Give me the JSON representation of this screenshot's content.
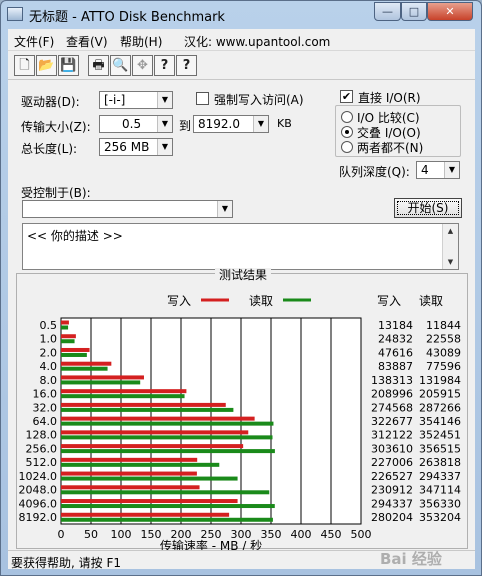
{
  "window": {
    "title": "无标题 - ATTO Disk Benchmark",
    "minimize": "—",
    "maximize": "□",
    "close": "✕"
  },
  "menu": [
    {
      "label": "文件(F)"
    },
    {
      "label": "查看(V)"
    },
    {
      "label": "帮助(H)"
    },
    {
      "label": "汉化: www.upantool.com"
    }
  ],
  "toolbar": [
    {
      "icon": "new-document-icon",
      "glyph": "🗋"
    },
    {
      "icon": "open-folder-icon",
      "glyph": "📂"
    },
    {
      "icon": "save-icon",
      "glyph": "💾"
    },
    {
      "icon": "print-icon",
      "glyph": "🖶"
    },
    {
      "icon": "print-preview-icon",
      "glyph": "🔍"
    },
    {
      "icon": "move-icon",
      "glyph": "✥"
    },
    {
      "icon": "help-icon",
      "glyph": "?"
    },
    {
      "icon": "context-help-icon",
      "glyph": "?"
    }
  ],
  "settings": {
    "drive_label": "驱动器(D):",
    "drive_value": "[-i-]",
    "force_write_label": "强制写入访问(A)",
    "transfer_size_label": "传输大小(Z):",
    "transfer_from": "0.5",
    "to_label": "到",
    "transfer_to": "8192.0",
    "kb_label": "KB",
    "total_length_label": "总长度(L):",
    "total_length_value": "256 MB",
    "direct_io_label": "直接 I/O(R)",
    "io_compare_label": "I/O 比较(C)",
    "overlapped_io_label": "交叠 I/O(O)",
    "neither_label": "两者都不(N)",
    "queue_depth_label": "队列深度(Q):",
    "queue_depth_value": "4",
    "controlled_by_label": "受控制于(B):",
    "controlled_by_value": "",
    "start_button": "开始(S)"
  },
  "description": "<<  你的描述  >>",
  "results": {
    "title": "测试结果",
    "write_legend": "写入",
    "read_legend": "读取",
    "write_header": "写入",
    "read_header": "读取",
    "xlabel": "传输速率 - MB / 秒"
  },
  "colors": {
    "write": "#d42020",
    "read": "#1a8a1a"
  },
  "chart_data": {
    "type": "bar",
    "title": "测试结果",
    "xlabel": "传输速率 - MB / 秒",
    "xlim": [
      0,
      500
    ],
    "xticks": [
      0,
      50,
      100,
      150,
      200,
      250,
      300,
      350,
      400,
      450,
      500
    ],
    "categories": [
      "0.5",
      "1.0",
      "2.0",
      "4.0",
      "8.0",
      "16.0",
      "32.0",
      "64.0",
      "128.0",
      "256.0",
      "512.0",
      "1024.0",
      "2048.0",
      "4096.0",
      "8192.0"
    ],
    "series": [
      {
        "name": "写入",
        "values": [
          13184,
          24832,
          47616,
          83887,
          138313,
          208996,
          274568,
          322677,
          312122,
          303610,
          227006,
          226527,
          230912,
          294337,
          280204
        ]
      },
      {
        "name": "读取",
        "values": [
          11844,
          22558,
          43089,
          77596,
          131984,
          205915,
          287266,
          354146,
          352451,
          356515,
          263818,
          294337,
          347114,
          356330,
          353204
        ]
      }
    ],
    "bar_values_mbps": {
      "write": [
        13.2,
        24.8,
        47.6,
        83.9,
        138.3,
        209.0,
        274.6,
        322.7,
        312.1,
        303.6,
        227.0,
        226.5,
        230.9,
        294.3,
        280.2
      ],
      "read": [
        11.8,
        22.6,
        43.1,
        77.6,
        132.0,
        205.9,
        287.3,
        354.1,
        352.5,
        356.5,
        263.8,
        294.3,
        347.1,
        356.3,
        353.2
      ]
    }
  },
  "status": "要获得帮助, 请按 F1",
  "watermark": "Bai 经验"
}
